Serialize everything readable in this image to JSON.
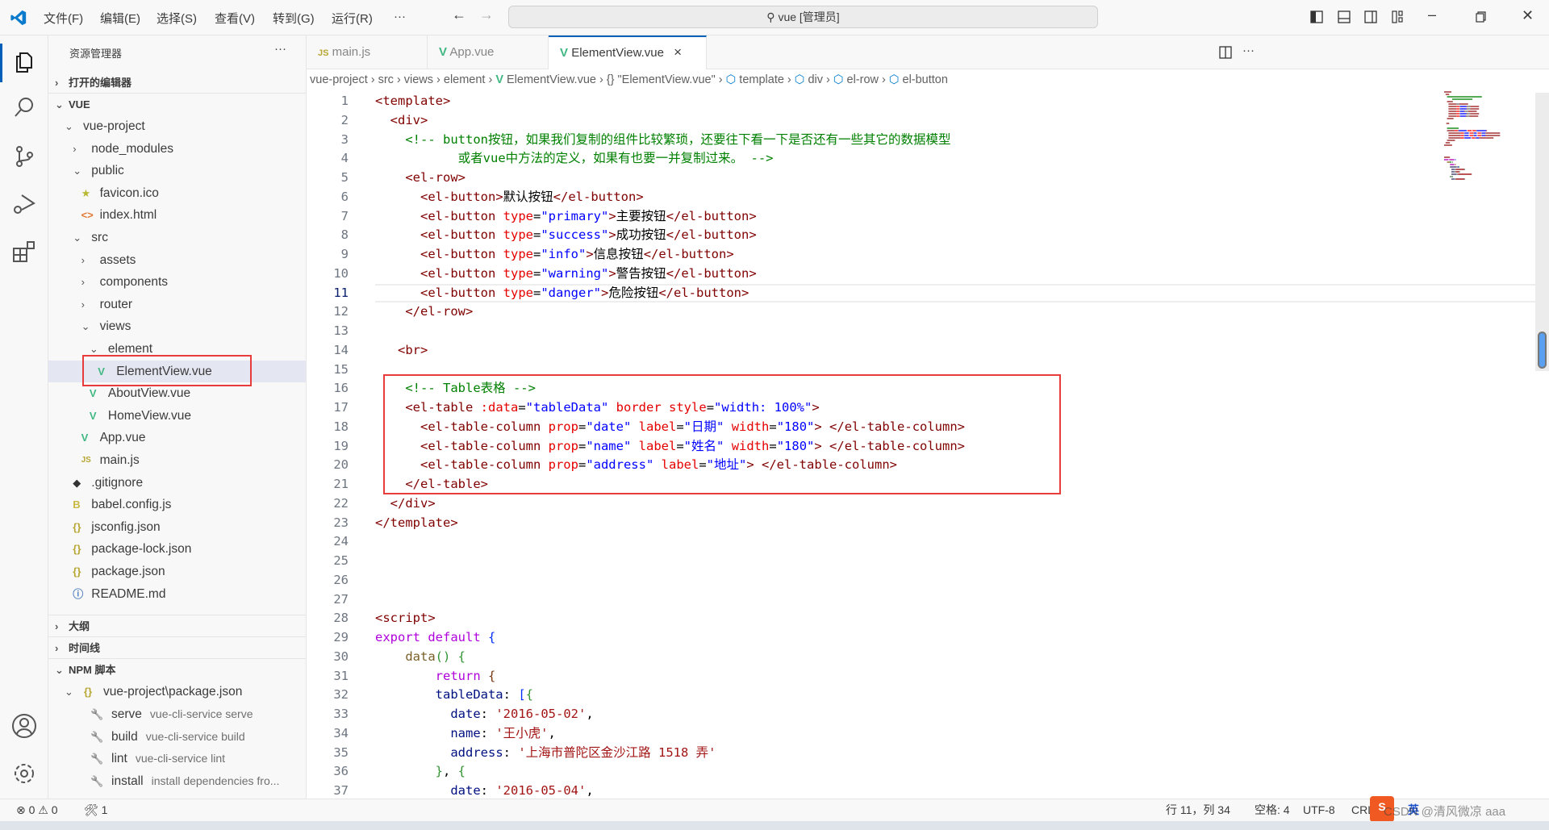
{
  "titlebar": {
    "menus": [
      "文件(F)",
      "编辑(E)",
      "选择(S)",
      "查看(V)",
      "转到(G)",
      "运行(R)",
      "···"
    ],
    "search_text": "vue [管理员]"
  },
  "sidebar": {
    "title": "资源管理器",
    "more": "···",
    "open_editors": "打开的编辑器",
    "root": "VUE",
    "tree": [
      {
        "label": "vue-project",
        "depth": 0,
        "type": "folder-open"
      },
      {
        "label": "node_modules",
        "depth": 1,
        "type": "folder"
      },
      {
        "label": "public",
        "depth": 1,
        "type": "folder-open"
      },
      {
        "label": "favicon.ico",
        "depth": 2,
        "type": "star"
      },
      {
        "label": "index.html",
        "depth": 2,
        "type": "html"
      },
      {
        "label": "src",
        "depth": 1,
        "type": "folder-open"
      },
      {
        "label": "assets",
        "depth": 2,
        "type": "folder"
      },
      {
        "label": "components",
        "depth": 2,
        "type": "folder"
      },
      {
        "label": "router",
        "depth": 2,
        "type": "folder"
      },
      {
        "label": "views",
        "depth": 2,
        "type": "folder-open"
      },
      {
        "label": "element",
        "depth": 3,
        "type": "folder-open"
      },
      {
        "label": "ElementView.vue",
        "depth": 4,
        "type": "vue",
        "selected": true
      },
      {
        "label": "AboutView.vue",
        "depth": 3,
        "type": "vue"
      },
      {
        "label": "HomeView.vue",
        "depth": 3,
        "type": "vue"
      },
      {
        "label": "App.vue",
        "depth": 2,
        "type": "vue"
      },
      {
        "label": "main.js",
        "depth": 2,
        "type": "js"
      },
      {
        "label": ".gitignore",
        "depth": 1,
        "type": "git"
      },
      {
        "label": "babel.config.js",
        "depth": 1,
        "type": "babel"
      },
      {
        "label": "jsconfig.json",
        "depth": 1,
        "type": "json"
      },
      {
        "label": "package-lock.json",
        "depth": 1,
        "type": "json"
      },
      {
        "label": "package.json",
        "depth": 1,
        "type": "json"
      },
      {
        "label": "README.md",
        "depth": 1,
        "type": "info"
      }
    ],
    "outline": "大纲",
    "timeline": "时间线",
    "npm": {
      "title": "NPM 脚本",
      "package": "vue-project\\package.json",
      "scripts": [
        {
          "name": "serve",
          "cmd": "vue-cli-service serve"
        },
        {
          "name": "build",
          "cmd": "vue-cli-service build"
        },
        {
          "name": "lint",
          "cmd": "vue-cli-service lint"
        },
        {
          "name": "install",
          "cmd": "install dependencies fro..."
        }
      ]
    }
  },
  "tabs": [
    {
      "label": "main.js",
      "icon": "JS"
    },
    {
      "label": "App.vue",
      "icon": "V"
    },
    {
      "label": "ElementView.vue",
      "icon": "V",
      "active": true,
      "close": "×"
    }
  ],
  "breadcrumb": [
    "vue-project",
    "src",
    "views",
    "element",
    "ElementView.vue",
    "{} \"ElementView.vue\"",
    "template",
    "div",
    "el-row",
    "el-button"
  ],
  "editor": {
    "current_line": 11,
    "lines": [
      [
        [
          "t",
          "<template>"
        ]
      ],
      [
        [
          "p",
          "  "
        ],
        [
          "t",
          "<div>"
        ]
      ],
      [
        [
          "p",
          "    "
        ],
        [
          "c",
          "<!-- button按钮，如果我们复制的组件比较繁琐，还要往下看一下是否还有一些其它的数据模型"
        ]
      ],
      [
        [
          "p",
          "           "
        ],
        [
          "c",
          "或者vue中方法的定义，如果有也要一并复制过来。 -->"
        ]
      ],
      [
        [
          "p",
          "    "
        ],
        [
          "t",
          "<el-row>"
        ]
      ],
      [
        [
          "p",
          "      "
        ],
        [
          "t",
          "<el-button>"
        ],
        [
          "p",
          "默认按钮"
        ],
        [
          "t",
          "</el-button>"
        ]
      ],
      [
        [
          "p",
          "      "
        ],
        [
          "t",
          "<el-button "
        ],
        [
          "a",
          "type"
        ],
        [
          "p",
          "="
        ],
        [
          "v",
          "\"primary\""
        ],
        [
          "t",
          ">"
        ],
        [
          "p",
          "主要按钮"
        ],
        [
          "t",
          "</el-button>"
        ]
      ],
      [
        [
          "p",
          "      "
        ],
        [
          "t",
          "<el-button "
        ],
        [
          "a",
          "type"
        ],
        [
          "p",
          "="
        ],
        [
          "v",
          "\"success\""
        ],
        [
          "t",
          ">"
        ],
        [
          "p",
          "成功按钮"
        ],
        [
          "t",
          "</el-button>"
        ]
      ],
      [
        [
          "p",
          "      "
        ],
        [
          "t",
          "<el-button "
        ],
        [
          "a",
          "type"
        ],
        [
          "p",
          "="
        ],
        [
          "v",
          "\"info\""
        ],
        [
          "t",
          ">"
        ],
        [
          "p",
          "信息按钮"
        ],
        [
          "t",
          "</el-button>"
        ]
      ],
      [
        [
          "p",
          "      "
        ],
        [
          "t",
          "<el-button "
        ],
        [
          "a",
          "type"
        ],
        [
          "p",
          "="
        ],
        [
          "v",
          "\"warning\""
        ],
        [
          "t",
          ">"
        ],
        [
          "p",
          "警告按钮"
        ],
        [
          "t",
          "</el-button>"
        ]
      ],
      [
        [
          "p",
          "      "
        ],
        [
          "t",
          "<el-button "
        ],
        [
          "a",
          "type"
        ],
        [
          "p",
          "="
        ],
        [
          "v",
          "\"danger\""
        ],
        [
          "t",
          ">"
        ],
        [
          "p",
          "危险按钮"
        ],
        [
          "t",
          "</el-button>"
        ]
      ],
      [
        [
          "p",
          "    "
        ],
        [
          "t",
          "</el-row>"
        ]
      ],
      [],
      [
        [
          "p",
          "   "
        ],
        [
          "t",
          "<br>"
        ]
      ],
      [],
      [
        [
          "p",
          "    "
        ],
        [
          "c",
          "<!-- Table表格 -->"
        ]
      ],
      [
        [
          "p",
          "    "
        ],
        [
          "t",
          "<el-table "
        ],
        [
          "a",
          ":data"
        ],
        [
          "p",
          "="
        ],
        [
          "v",
          "\"tableData\""
        ],
        [
          "p",
          " "
        ],
        [
          "a",
          "border"
        ],
        [
          "p",
          " "
        ],
        [
          "a",
          "style"
        ],
        [
          "p",
          "="
        ],
        [
          "v",
          "\"width: 100%\""
        ],
        [
          "t",
          ">"
        ]
      ],
      [
        [
          "p",
          "      "
        ],
        [
          "t",
          "<el-table-column "
        ],
        [
          "a",
          "prop"
        ],
        [
          "p",
          "="
        ],
        [
          "v",
          "\"date\""
        ],
        [
          "p",
          " "
        ],
        [
          "a",
          "label"
        ],
        [
          "p",
          "="
        ],
        [
          "v",
          "\"日期\""
        ],
        [
          "p",
          " "
        ],
        [
          "a",
          "width"
        ],
        [
          "p",
          "="
        ],
        [
          "v",
          "\"180\""
        ],
        [
          "t",
          "> </el-table-column>"
        ]
      ],
      [
        [
          "p",
          "      "
        ],
        [
          "t",
          "<el-table-column "
        ],
        [
          "a",
          "prop"
        ],
        [
          "p",
          "="
        ],
        [
          "v",
          "\"name\""
        ],
        [
          "p",
          " "
        ],
        [
          "a",
          "label"
        ],
        [
          "p",
          "="
        ],
        [
          "v",
          "\"姓名\""
        ],
        [
          "p",
          " "
        ],
        [
          "a",
          "width"
        ],
        [
          "p",
          "="
        ],
        [
          "v",
          "\"180\""
        ],
        [
          "t",
          "> </el-table-column>"
        ]
      ],
      [
        [
          "p",
          "      "
        ],
        [
          "t",
          "<el-table-column "
        ],
        [
          "a",
          "prop"
        ],
        [
          "p",
          "="
        ],
        [
          "v",
          "\"address\""
        ],
        [
          "p",
          " "
        ],
        [
          "a",
          "label"
        ],
        [
          "p",
          "="
        ],
        [
          "v",
          "\"地址\""
        ],
        [
          "t",
          "> </el-table-column>"
        ]
      ],
      [
        [
          "p",
          "    "
        ],
        [
          "t",
          "</el-table>"
        ]
      ],
      [
        [
          "p",
          "  "
        ],
        [
          "t",
          "</div>"
        ]
      ],
      [
        [
          "t",
          "</template>"
        ]
      ],
      [],
      [],
      [],
      [],
      [
        [
          "t",
          "<script>"
        ]
      ],
      [
        [
          "k",
          "export"
        ],
        [
          "p",
          " "
        ],
        [
          "k",
          "default"
        ],
        [
          "p",
          " "
        ],
        [
          "b1",
          "{"
        ]
      ],
      [
        [
          "p",
          "    "
        ],
        [
          "f",
          "data"
        ],
        [
          "b2",
          "()"
        ],
        [
          "p",
          " "
        ],
        [
          "b2",
          "{"
        ]
      ],
      [
        [
          "p",
          "        "
        ],
        [
          "k",
          "return"
        ],
        [
          "p",
          " "
        ],
        [
          "b3",
          "{"
        ]
      ],
      [
        [
          "p",
          "        "
        ],
        [
          "n",
          "tableData"
        ],
        [
          "p",
          ": "
        ],
        [
          "b1",
          "["
        ],
        [
          "b2",
          "{"
        ]
      ],
      [
        [
          "p",
          "          "
        ],
        [
          "n",
          "date"
        ],
        [
          "p",
          ": "
        ],
        [
          "s",
          "'2016-05-02'"
        ],
        [
          "p",
          ","
        ]
      ],
      [
        [
          "p",
          "          "
        ],
        [
          "n",
          "name"
        ],
        [
          "p",
          ": "
        ],
        [
          "s",
          "'王小虎'"
        ],
        [
          "p",
          ","
        ]
      ],
      [
        [
          "p",
          "          "
        ],
        [
          "n",
          "address"
        ],
        [
          "p",
          ": "
        ],
        [
          "s",
          "'上海市普陀区金沙江路 1518 弄'"
        ]
      ],
      [
        [
          "p",
          "        "
        ],
        [
          "b2",
          "}"
        ],
        [
          "p",
          ", "
        ],
        [
          "b2",
          "{"
        ]
      ],
      [
        [
          "p",
          "          "
        ],
        [
          "n",
          "date"
        ],
        [
          "p",
          ": "
        ],
        [
          "s",
          "'2016-05-04'"
        ],
        [
          "p",
          ","
        ]
      ]
    ]
  },
  "statusbar": {
    "errors": "0",
    "warnings": "0",
    "ports": "1",
    "position": "行 11，列 34",
    "indent": "空格: 4",
    "encoding": "UTF-8",
    "eol": "CRL",
    "watermark": "CSDN @清风微凉 aaa",
    "ime": "英"
  },
  "colors": {
    "accent": "#005fb8",
    "highlight_box": "#e83b3b",
    "vue_icon": "#41b883"
  }
}
